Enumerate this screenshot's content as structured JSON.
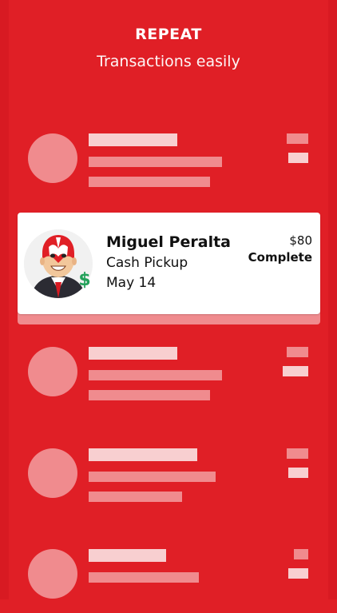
{
  "header": {
    "title": "REPEAT",
    "subtitle": "Transactions easily"
  },
  "featured_transaction": {
    "name": "Miguel Peralta",
    "type": "Cash Pickup",
    "date": "May 14",
    "amount": "$80",
    "status": "Complete",
    "badge_icon": "dollar-sign-icon",
    "badge_symbol": "$"
  },
  "colors": {
    "background": "#e01f26",
    "placeholder_light": "#f8cfd0",
    "placeholder_mid": "#f08b8e",
    "card": "#ffffff",
    "badge": "#23a15a"
  }
}
